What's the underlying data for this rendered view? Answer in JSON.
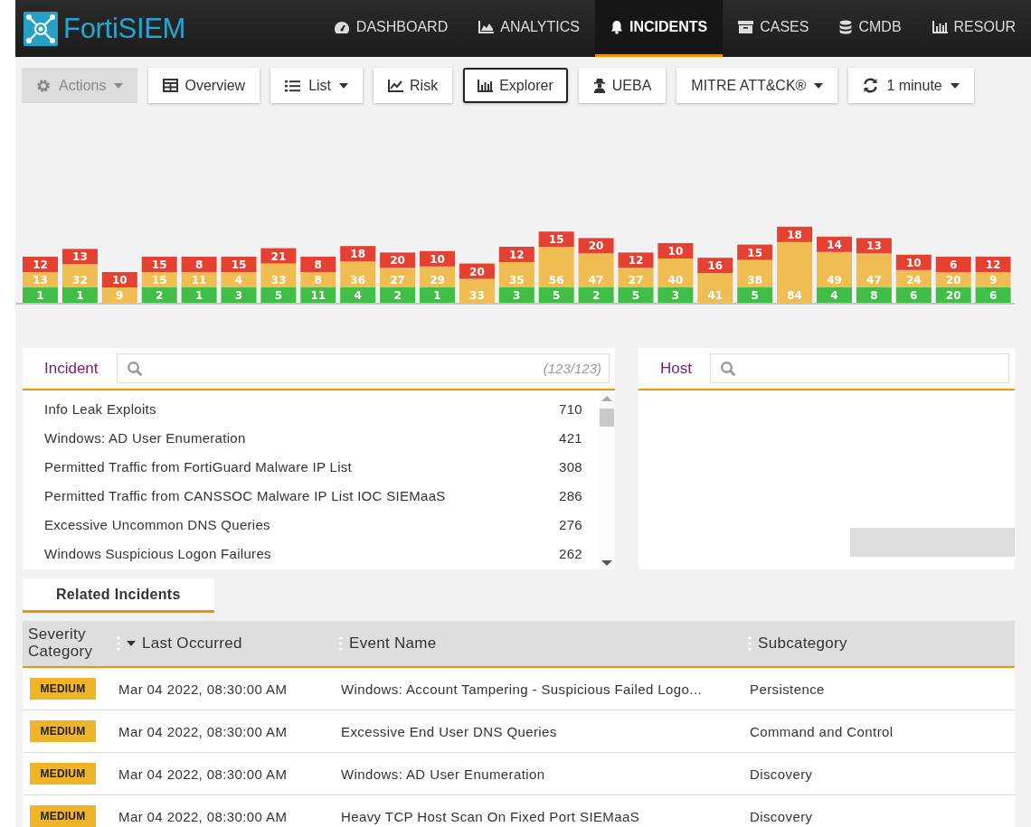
{
  "brand": {
    "name": "FortiSIEM"
  },
  "nav": [
    {
      "label": "DASHBOARD",
      "selected": false
    },
    {
      "label": "ANALYTICS",
      "selected": false
    },
    {
      "label": "INCIDENTS",
      "selected": true
    },
    {
      "label": "CASES",
      "selected": false
    },
    {
      "label": "CMDB",
      "selected": false
    },
    {
      "label": "RESOUR",
      "selected": false
    }
  ],
  "toolbar": [
    {
      "label": "Actions",
      "kind": "menu",
      "disabled": true,
      "selected": false
    },
    {
      "label": "Overview",
      "kind": "button",
      "disabled": false,
      "selected": false
    },
    {
      "label": "List",
      "kind": "menu",
      "disabled": false,
      "selected": false
    },
    {
      "label": "Risk",
      "kind": "button",
      "disabled": false,
      "selected": false
    },
    {
      "label": "Explorer",
      "kind": "button",
      "disabled": false,
      "selected": true
    },
    {
      "label": "UEBA",
      "kind": "button",
      "disabled": false,
      "selected": false
    },
    {
      "label": "MITRE ATT&CK®",
      "kind": "menu",
      "disabled": false,
      "selected": false
    },
    {
      "label": "1 minute",
      "kind": "menu",
      "disabled": false,
      "selected": false
    }
  ],
  "histogram": {
    "bars": [
      {
        "high": "12",
        "medium": "13",
        "low": "1"
      },
      {
        "high": "13",
        "medium": "32",
        "low": "1"
      },
      {
        "high": "10",
        "medium": "9"
      },
      {
        "high": "15",
        "medium": "15",
        "low": "2"
      },
      {
        "high": "8",
        "medium": "11",
        "low": "1"
      },
      {
        "high": "15",
        "medium": "4",
        "low": "3"
      },
      {
        "high": "21",
        "medium": "33",
        "low": "5"
      },
      {
        "high": "8",
        "medium": "8",
        "low": "11"
      },
      {
        "high": "18",
        "medium": "36",
        "low": "4"
      },
      {
        "high": "20",
        "medium": "27",
        "low": "2"
      },
      {
        "high": "10",
        "medium": "29",
        "low": "1"
      },
      {
        "high": "20",
        "medium": "33"
      },
      {
        "high": "12",
        "medium": "35",
        "low": "3"
      },
      {
        "high": "15",
        "medium": "56",
        "low": "5"
      },
      {
        "high": "20",
        "medium": "47",
        "low": "2"
      },
      {
        "high": "12",
        "medium": "27",
        "low": "5"
      },
      {
        "high": "10",
        "medium": "40",
        "low": "3"
      },
      {
        "high": "16",
        "medium": "41"
      },
      {
        "high": "15",
        "medium": "38",
        "low": "5"
      },
      {
        "high": "18",
        "medium": "84"
      },
      {
        "high": "14",
        "medium": "49",
        "low": "4"
      },
      {
        "high": "13",
        "medium": "47",
        "low": "8"
      },
      {
        "high": "10",
        "medium": "24",
        "low": "6"
      },
      {
        "high": "6",
        "medium": "20",
        "low": "20"
      },
      {
        "high": "12",
        "medium": "9",
        "low": "6"
      }
    ]
  },
  "incident_panel": {
    "title": "Incident",
    "count": "(123/123)",
    "rows": [
      {
        "name": "Info Leak Exploits",
        "count": "710"
      },
      {
        "name": "Windows: AD User Enumeration",
        "count": "421"
      },
      {
        "name": "Permitted Traffic from FortiGuard Malware IP List",
        "count": "308"
      },
      {
        "name": "Permitted Traffic from CANSSOC Malware IP List IOC SIEMaaS",
        "count": "286"
      },
      {
        "name": "Excessive Uncommon DNS Queries",
        "count": "276"
      },
      {
        "name": "Windows Suspicious Logon Failures",
        "count": "262"
      }
    ]
  },
  "host_panel": {
    "title": "Host"
  },
  "related_tabs": [
    {
      "label": "Related Incidents",
      "selected": true
    }
  ],
  "table": {
    "columns": [
      {
        "label": "Severity Category",
        "sorted": false
      },
      {
        "label": "Last Occurred",
        "sorted": true
      },
      {
        "label": "Event Name",
        "sorted": false
      },
      {
        "label": "Subcategory",
        "sorted": false
      }
    ],
    "rows": [
      {
        "severity": "MEDIUM",
        "last_occurred": "Mar 04 2022, 08:30:00 AM",
        "event_name": "Windows: Account Tampering - Suspicious Failed Logo...",
        "subcategory": "Persistence"
      },
      {
        "severity": "MEDIUM",
        "last_occurred": "Mar 04 2022, 08:30:00 AM",
        "event_name": "Excessive End User DNS Queries",
        "subcategory": "Command and Control"
      },
      {
        "severity": "MEDIUM",
        "last_occurred": "Mar 04 2022, 08:30:00 AM",
        "event_name": "Windows: AD User Enumeration",
        "subcategory": "Discovery"
      },
      {
        "severity": "MEDIUM",
        "last_occurred": "Mar 04 2022, 08:30:00 AM",
        "event_name": "Heavy TCP Host Scan On Fixed Port SIEMaaS",
        "subcategory": "Discovery"
      }
    ]
  }
}
